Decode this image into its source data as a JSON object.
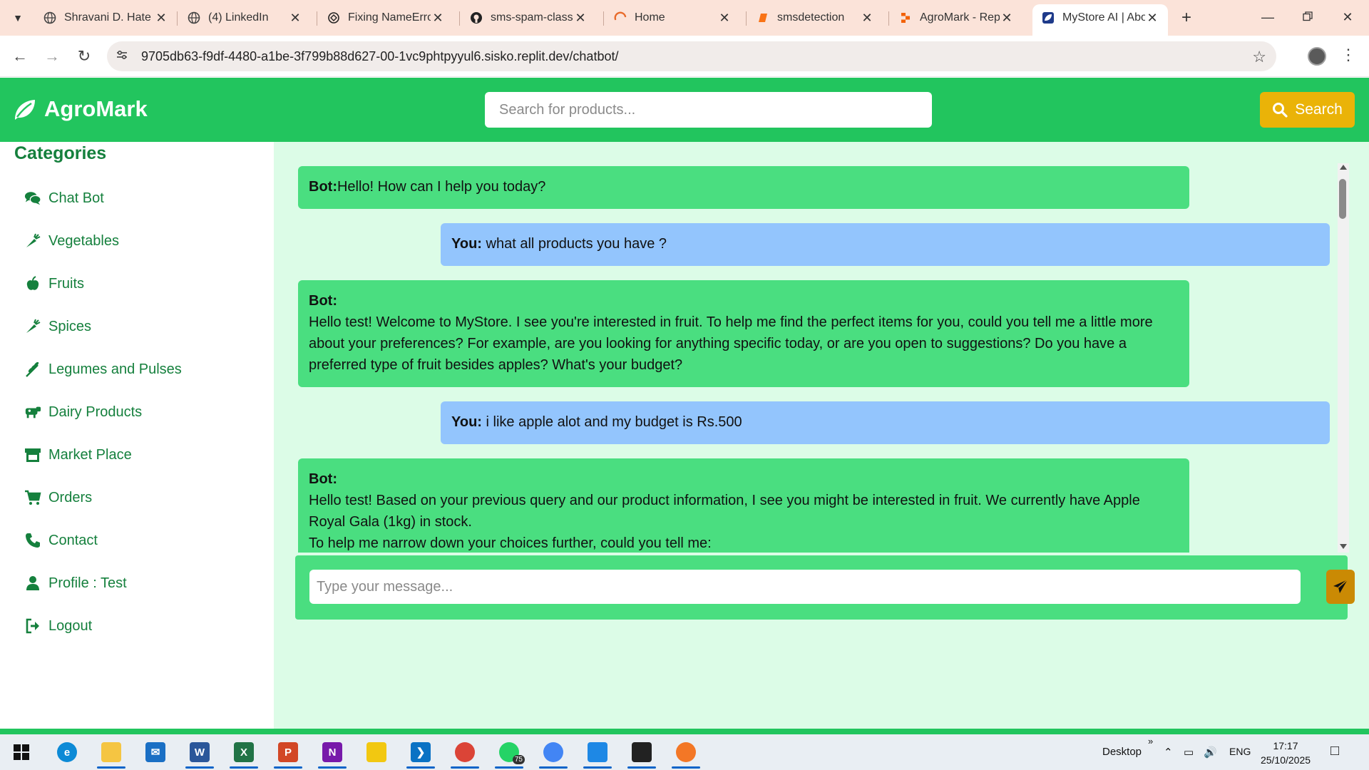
{
  "browser": {
    "tabs": [
      {
        "title": "Shravani D. Hate",
        "icon": "globe-icon"
      },
      {
        "title": "(4) LinkedIn",
        "icon": "globe-icon"
      },
      {
        "title": "Fixing NameErro",
        "icon": "openai-icon"
      },
      {
        "title": "sms-spam-classi",
        "icon": "github-icon"
      },
      {
        "title": "Home",
        "icon": "loading-icon"
      },
      {
        "title": "smsdetection",
        "icon": "book-icon"
      },
      {
        "title": "AgroMark - Repl",
        "icon": "replit-icon"
      },
      {
        "title": "MyStore AI | Abo",
        "icon": "leaf-icon"
      }
    ],
    "active_tab_index": 7,
    "url": "9705db63-f9df-4480-a1be-3f799b88d627-00-1vc9phtpyyul6.sisko.replit.dev/chatbot/"
  },
  "header": {
    "brand": "AgroMark",
    "search_placeholder": "Search for products...",
    "search_button": "Search"
  },
  "sidebar": {
    "heading": "Categories",
    "items": [
      {
        "label": "Chat Bot",
        "icon": "chat-icon"
      },
      {
        "label": "Vegetables",
        "icon": "carrot-icon"
      },
      {
        "label": "Fruits",
        "icon": "apple-icon"
      },
      {
        "label": "Spices",
        "icon": "pepper-icon"
      },
      {
        "label": "Legumes and Pulses",
        "icon": "seedling-icon"
      },
      {
        "label": "Dairy Products",
        "icon": "cow-icon"
      },
      {
        "label": "Market Place",
        "icon": "store-icon"
      },
      {
        "label": "Orders",
        "icon": "cart-icon"
      },
      {
        "label": "Contact",
        "icon": "phone-icon"
      },
      {
        "label": "Profile : Test",
        "icon": "user-icon"
      },
      {
        "label": "Logout",
        "icon": "logout-icon"
      }
    ]
  },
  "chat": {
    "messages": [
      {
        "sender": "Bot:",
        "text": "Hello! How can I help you today?"
      },
      {
        "sender": "You:",
        "text": "what all products you have ?"
      },
      {
        "sender": "Bot:",
        "text": "Hello test! Welcome to MyStore. I see you're interested in fruit. To help me find the perfect items for you, could you tell me a little more about your preferences? For example, are you looking for anything specific today, or are you open to suggestions? Do you have a preferred type of fruit besides apples? What's your budget?"
      },
      {
        "sender": "You:",
        "text": "i like apple alot and my budget is Rs.500"
      },
      {
        "sender": "Bot:",
        "text": "Hello test! Based on your previous query and our product information, I see you might be interested in fruit. We currently have Apple Royal Gala (1kg) in stock.",
        "text2": "To help me narrow down your choices further, could you tell me:"
      }
    ],
    "input_placeholder": "Type your message..."
  },
  "taskbar": {
    "desktop_label": "Desktop",
    "language": "ENG",
    "time": "17:17",
    "date": "25/10/2025",
    "whatsapp_badge": "75"
  },
  "colors": {
    "brand_green": "#22c55e",
    "bot_bubble": "#4ade80",
    "user_bubble": "#93c5fd",
    "accent_yellow": "#eab308",
    "page_bg": "#dcfce7"
  }
}
